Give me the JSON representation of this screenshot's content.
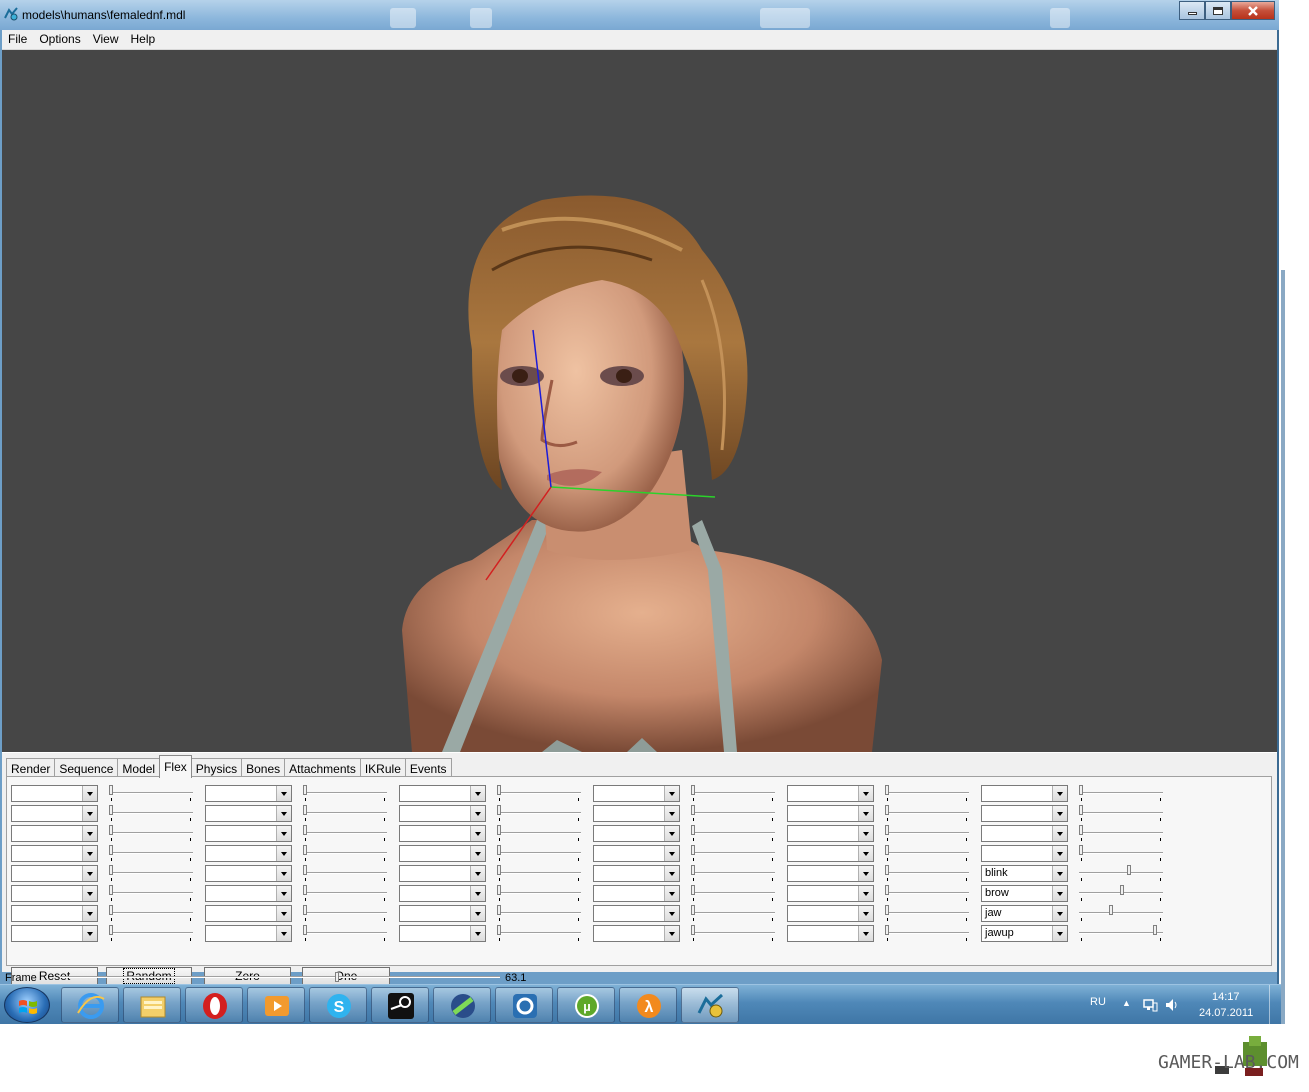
{
  "window": {
    "title": "models\\humans\\femalednf.mdl",
    "icon": "hlmv-icon",
    "caption_buttons": [
      "minimize-icon",
      "maximize-icon",
      "close-icon"
    ]
  },
  "menu": [
    "File",
    "Options",
    "View",
    "Help"
  ],
  "viewport": {
    "background": "#464646",
    "axis_colors": {
      "x": "#2bd22b",
      "y": "#d22020",
      "z": "#1c1cd8"
    }
  },
  "tabs": [
    {
      "label": "Render",
      "active": false
    },
    {
      "label": "Sequence",
      "active": false
    },
    {
      "label": "Model",
      "active": false
    },
    {
      "label": "Flex",
      "active": true
    },
    {
      "label": "Physics",
      "active": false
    },
    {
      "label": "Bones",
      "active": false
    },
    {
      "label": "Attachments",
      "active": false
    },
    {
      "label": "IKRule",
      "active": false
    },
    {
      "label": "Events",
      "active": false
    }
  ],
  "flex_columns": [
    {
      "rows": [
        {
          "value": "",
          "level": 0
        },
        {
          "value": "",
          "level": 0
        },
        {
          "value": "",
          "level": 0
        },
        {
          "value": "",
          "level": 0
        },
        {
          "value": "",
          "level": 0
        },
        {
          "value": "",
          "level": 0
        },
        {
          "value": "",
          "level": 0
        },
        {
          "value": "",
          "level": 0
        }
      ]
    },
    {
      "rows": [
        {
          "value": "",
          "level": 0
        },
        {
          "value": "",
          "level": 0
        },
        {
          "value": "",
          "level": 0
        },
        {
          "value": "",
          "level": 0
        },
        {
          "value": "",
          "level": 0
        },
        {
          "value": "",
          "level": 0
        },
        {
          "value": "",
          "level": 0
        },
        {
          "value": "",
          "level": 0
        }
      ]
    },
    {
      "rows": [
        {
          "value": "",
          "level": 0
        },
        {
          "value": "",
          "level": 0
        },
        {
          "value": "",
          "level": 0
        },
        {
          "value": "",
          "level": 0
        },
        {
          "value": "",
          "level": 0
        },
        {
          "value": "",
          "level": 0
        },
        {
          "value": "",
          "level": 0
        },
        {
          "value": "",
          "level": 0
        }
      ]
    },
    {
      "rows": [
        {
          "value": "",
          "level": 0
        },
        {
          "value": "",
          "level": 0
        },
        {
          "value": "",
          "level": 0
        },
        {
          "value": "",
          "level": 0
        },
        {
          "value": "",
          "level": 0
        },
        {
          "value": "",
          "level": 0
        },
        {
          "value": "",
          "level": 0
        },
        {
          "value": "",
          "level": 0
        }
      ]
    },
    {
      "rows": [
        {
          "value": "",
          "level": 0
        },
        {
          "value": "",
          "level": 0
        },
        {
          "value": "",
          "level": 0
        },
        {
          "value": "",
          "level": 0
        },
        {
          "value": "",
          "level": 0
        },
        {
          "value": "",
          "level": 0
        },
        {
          "value": "",
          "level": 0
        },
        {
          "value": "",
          "level": 0
        }
      ]
    },
    {
      "rows": [
        {
          "value": "",
          "level": 0
        },
        {
          "value": "",
          "level": 0
        },
        {
          "value": "",
          "level": 0
        },
        {
          "value": "",
          "level": 0
        },
        {
          "value": "blink",
          "level": 0.62
        },
        {
          "value": "brow",
          "level": 0.52
        },
        {
          "value": "jaw",
          "level": 0.38
        },
        {
          "value": "jawup",
          "level": 0.95
        }
      ]
    }
  ],
  "buttons": {
    "reset": "Reset",
    "random": "Random",
    "zero": "Zero",
    "one": "One"
  },
  "frame": {
    "label": "Frame",
    "value": "63.1",
    "position": 0.63
  },
  "taskbar": {
    "apps": [
      "internet-explorer-icon",
      "windows-explorer-icon",
      "opera-icon",
      "media-player-icon",
      "skype-icon",
      "steam-icon",
      "rainmeter-icon",
      "source-sdk-icon",
      "utorrent-icon",
      "half-life-icon",
      "hlmv-icon"
    ],
    "active_app": 10,
    "language": "RU",
    "time": "14:17",
    "date": "24.07.2011"
  },
  "watermark": "GAMER-LAB.COM"
}
